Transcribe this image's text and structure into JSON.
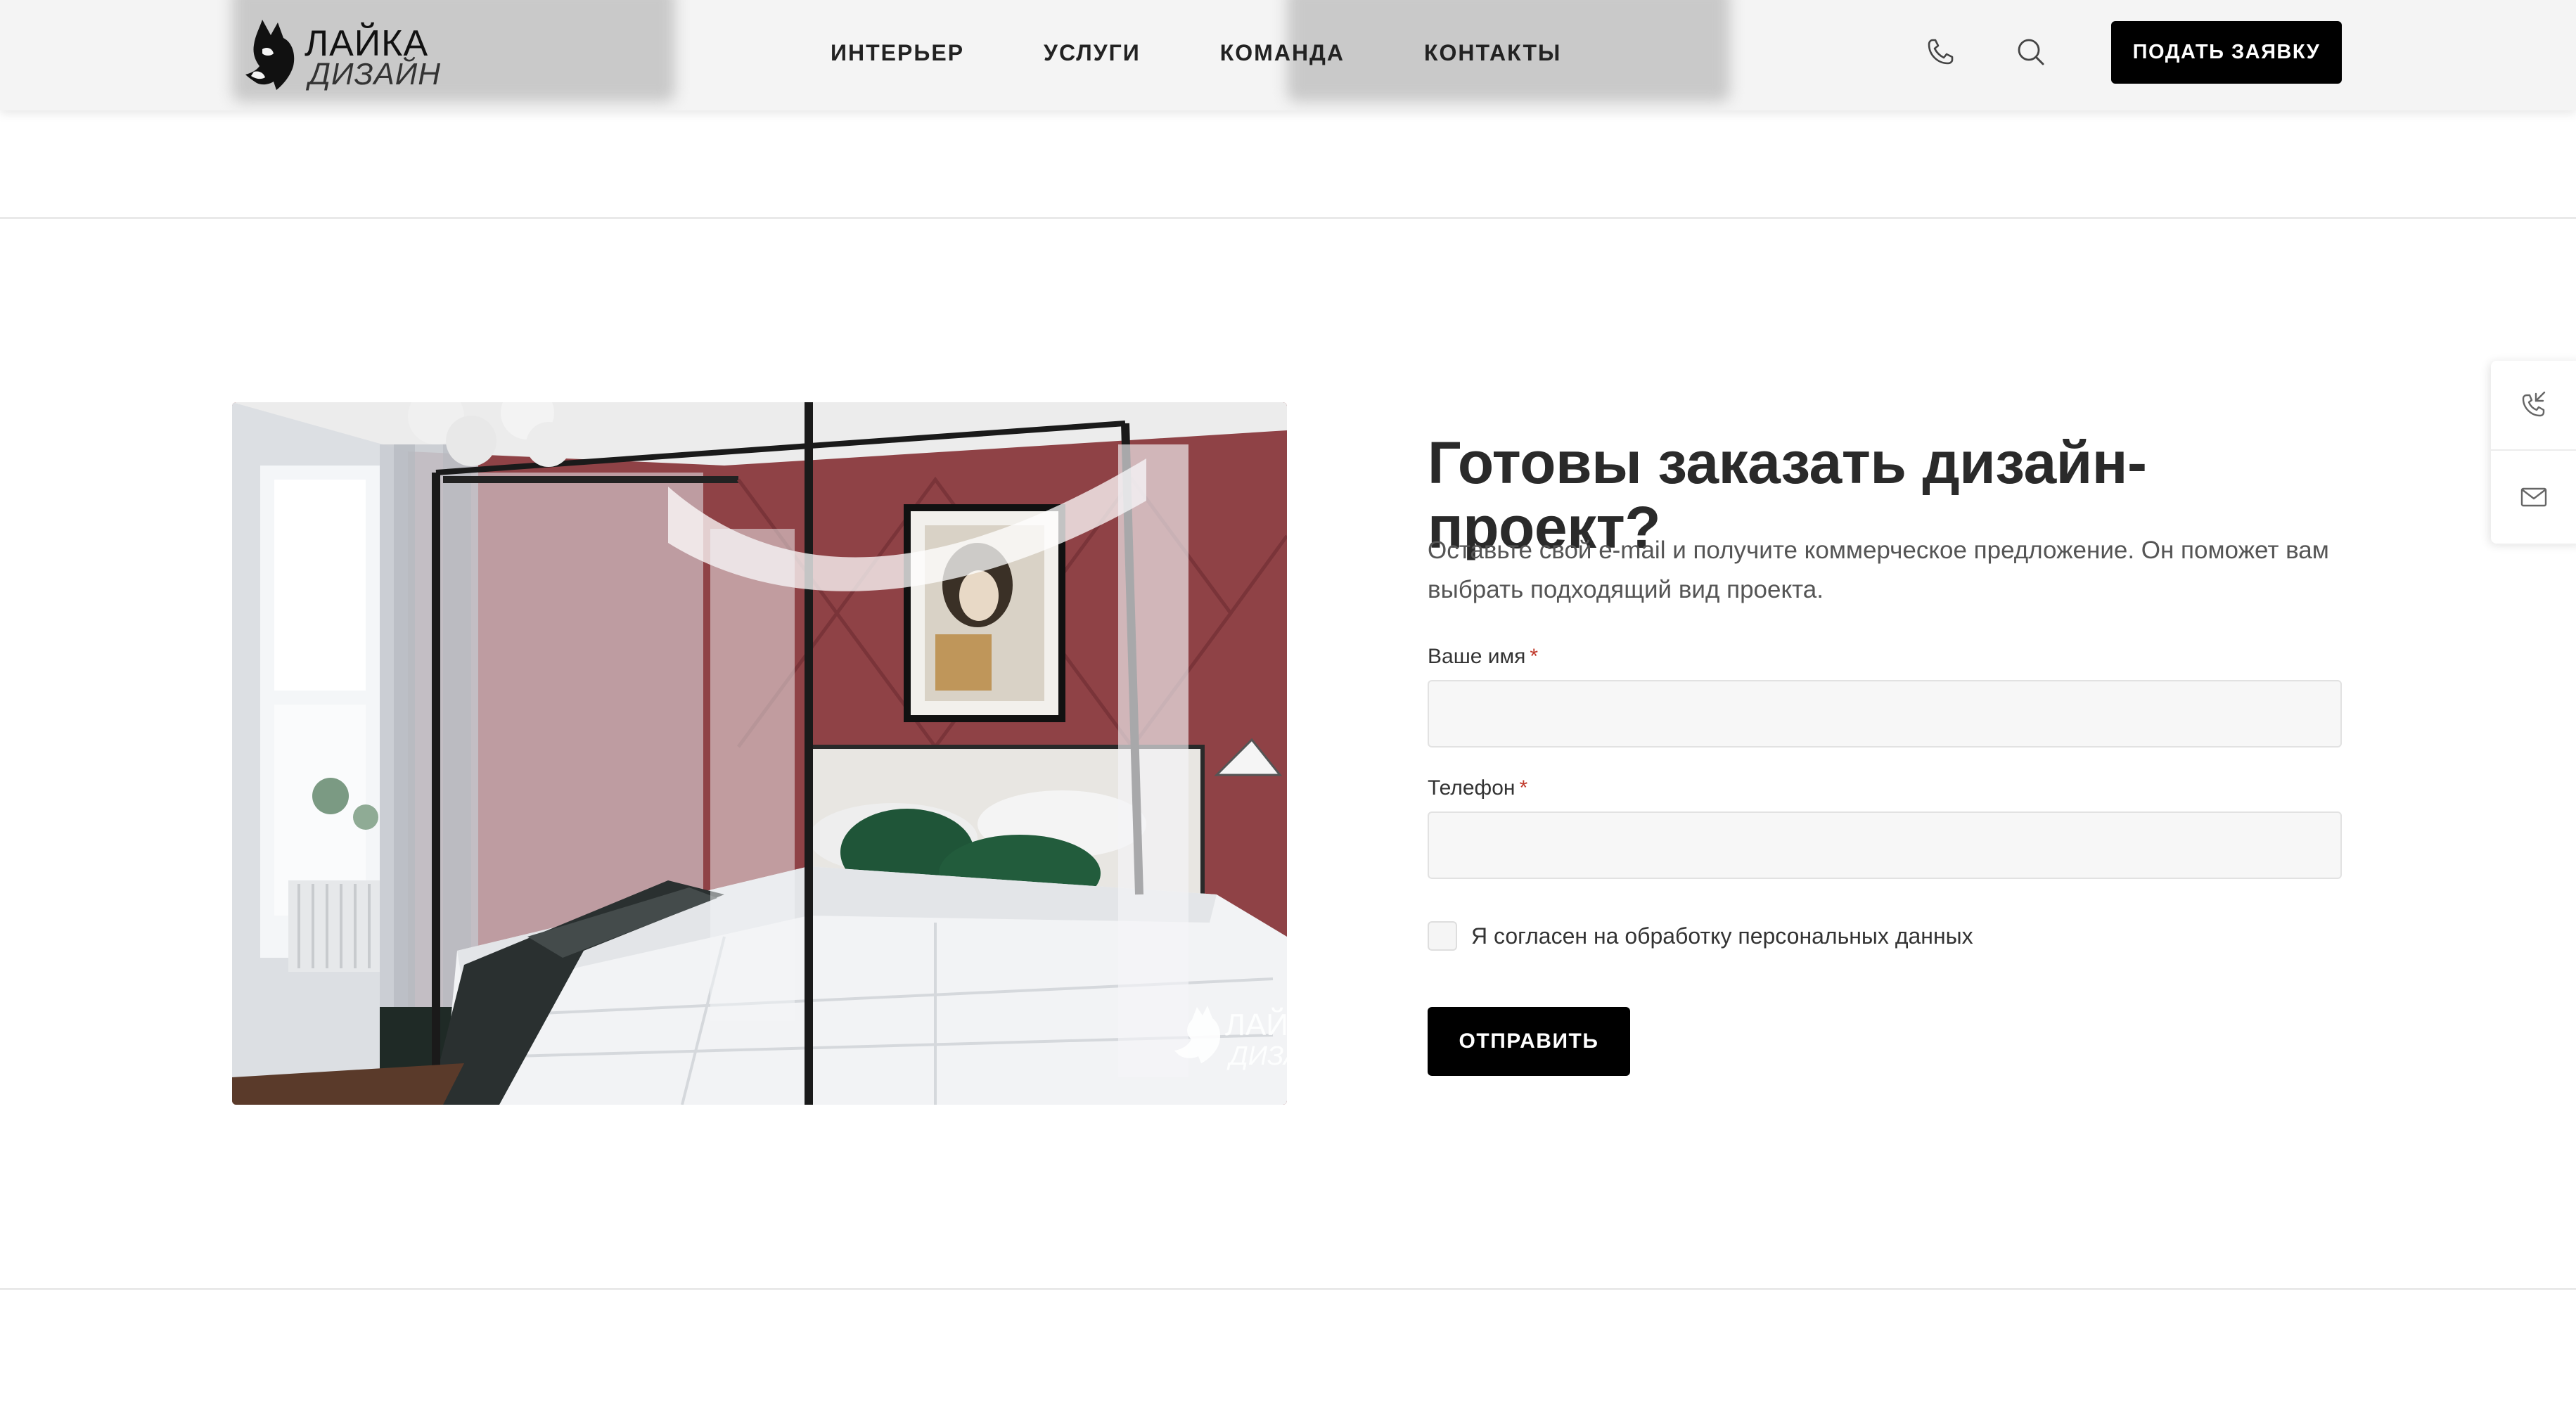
{
  "header": {
    "logo": {
      "line1": "ЛАЙКА",
      "line2": "ДИЗАЙН",
      "icon": "husky-dog-logo"
    },
    "nav": [
      {
        "label": "ИНТЕРЬЕР"
      },
      {
        "label": "УСЛУГИ"
      },
      {
        "label": "КОМАНДА"
      },
      {
        "label": "КОНТАКТЫ"
      }
    ],
    "icons": {
      "phone": "phone-icon",
      "search": "search-icon"
    },
    "cta_label": "ПОДАТЬ ЗАЯВКУ"
  },
  "hero_image": {
    "description_icon": "bedroom-interior-photo",
    "watermark": {
      "line1": "ЛАЙК",
      "line2": "ДИЗАЙ"
    }
  },
  "form": {
    "title": "Готовы заказать дизайн-проект?",
    "subtitle": "Оставьте свой e-mail и получите коммерческое предложение. Он поможет вам выбрать подходящий вид проекта.",
    "name_label": "Ваше имя",
    "name_value": "",
    "phone_label": "Телефон",
    "phone_value": "",
    "required_mark": "*",
    "consent_label": "Я согласен на обработку персональных данных",
    "consent_checked": false,
    "submit_label": "ОТПРАВИТЬ"
  },
  "side_widget": {
    "items": [
      {
        "icon": "callback-phone-icon"
      },
      {
        "icon": "mail-icon"
      }
    ]
  },
  "colors": {
    "accent": "#000000",
    "header_bg": "#f4f4f4",
    "required": "#c0392b",
    "field_bg": "#f7f7f7"
  }
}
